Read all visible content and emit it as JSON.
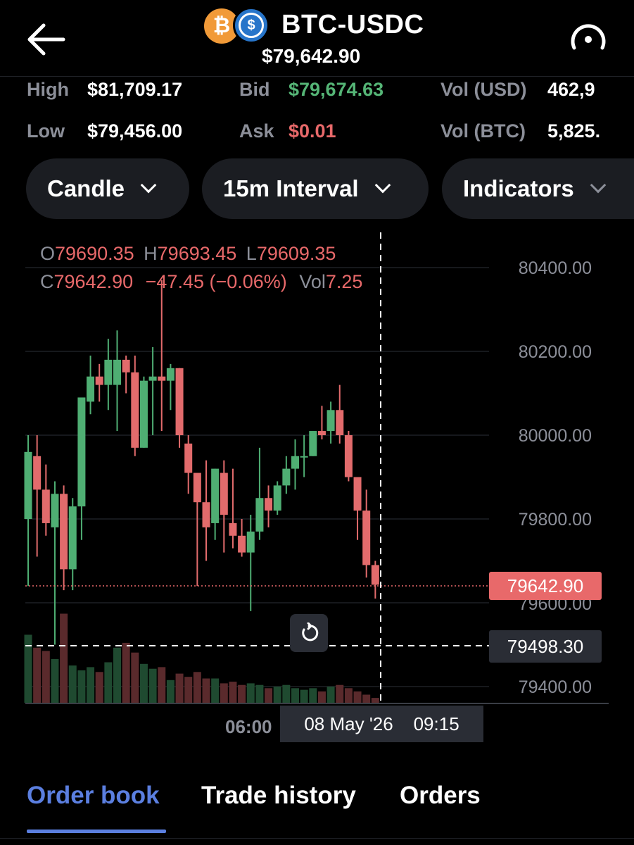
{
  "header": {
    "pair": "BTC-USDC",
    "price": "$79,642.90",
    "coin1_symbol": "₿",
    "coin2_symbol": "$"
  },
  "stats": {
    "high_label": "High",
    "high_value": "$81,709.17",
    "low_label": "Low",
    "low_value": "$79,456.00",
    "bid_label": "Bid",
    "bid_value": "$79,674.63",
    "ask_label": "Ask",
    "ask_value": "$0.01",
    "volusd_label": "Vol (USD)",
    "volusd_value": "462,9",
    "volbtc_label": "Vol (BTC)",
    "volbtc_value": "5,825."
  },
  "controls": {
    "chart_type": "Candle",
    "interval": "15m Interval",
    "indicators": "Indicators"
  },
  "ohlc": {
    "o_label": "O",
    "o_value": "79690.35",
    "h_label": "H",
    "h_value": "79693.45",
    "l_label": "L",
    "l_value": "79609.35",
    "c_label": "C",
    "c_value": "79642.90",
    "change": "−47.45 (−0.06%)",
    "vol_label": "Vol",
    "vol_value": "7.25"
  },
  "chart_data": {
    "type": "candlestick",
    "y_ticks": [
      "80400.00",
      "80200.00",
      "80000.00",
      "79800.00",
      "79600.00",
      "79400.00"
    ],
    "ylim": [
      79350,
      80500
    ],
    "x_tick": "06:00",
    "last_price_tag": "79642.90",
    "crosshair_price_tag": "79498.30",
    "crosshair_time": "08 May '26    09:15",
    "grid": true,
    "candles": [
      {
        "o": 79800,
        "h": 80000,
        "l": 79640,
        "c": 79960
      },
      {
        "o": 79950,
        "h": 80000,
        "l": 79710,
        "c": 79870
      },
      {
        "o": 79870,
        "h": 79930,
        "l": 79760,
        "c": 79790
      },
      {
        "o": 79780,
        "h": 79890,
        "l": 79500,
        "c": 79860
      },
      {
        "o": 79860,
        "h": 79880,
        "l": 79630,
        "c": 79680
      },
      {
        "o": 79680,
        "h": 79850,
        "l": 79630,
        "c": 79830
      },
      {
        "o": 79830,
        "h": 80060,
        "l": 79750,
        "c": 80090
      },
      {
        "o": 80080,
        "h": 80190,
        "l": 80050,
        "c": 80140
      },
      {
        "o": 80140,
        "h": 80170,
        "l": 80080,
        "c": 80120
      },
      {
        "o": 80120,
        "h": 80230,
        "l": 80060,
        "c": 80180
      },
      {
        "o": 80120,
        "h": 80250,
        "l": 80010,
        "c": 80180
      },
      {
        "o": 80180,
        "h": 80190,
        "l": 80100,
        "c": 80150
      },
      {
        "o": 80150,
        "h": 80190,
        "l": 79950,
        "c": 79970
      },
      {
        "o": 79970,
        "h": 80140,
        "l": 79970,
        "c": 80130
      },
      {
        "o": 80130,
        "h": 80210,
        "l": 80000,
        "c": 80140
      },
      {
        "o": 80140,
        "h": 80370,
        "l": 80010,
        "c": 80130
      },
      {
        "o": 80130,
        "h": 80170,
        "l": 80060,
        "c": 80160
      },
      {
        "o": 80160,
        "h": 80160,
        "l": 79970,
        "c": 80000
      },
      {
        "o": 79980,
        "h": 80000,
        "l": 79860,
        "c": 79910
      },
      {
        "o": 79910,
        "h": 79890,
        "l": 79640,
        "c": 79840
      },
      {
        "o": 79840,
        "h": 79940,
        "l": 79700,
        "c": 79780
      },
      {
        "o": 79790,
        "h": 79920,
        "l": 79750,
        "c": 79920
      },
      {
        "o": 79910,
        "h": 79940,
        "l": 79720,
        "c": 79810
      },
      {
        "o": 79790,
        "h": 79920,
        "l": 79730,
        "c": 79760
      },
      {
        "o": 79760,
        "h": 79800,
        "l": 79710,
        "c": 79720
      },
      {
        "o": 79720,
        "h": 79810,
        "l": 79580,
        "c": 79770
      },
      {
        "o": 79770,
        "h": 79970,
        "l": 79750,
        "c": 79850
      },
      {
        "o": 79850,
        "h": 79880,
        "l": 79780,
        "c": 79820
      },
      {
        "o": 79820,
        "h": 79890,
        "l": 79810,
        "c": 79880
      },
      {
        "o": 79880,
        "h": 79950,
        "l": 79860,
        "c": 79920
      },
      {
        "o": 79920,
        "h": 79990,
        "l": 79870,
        "c": 79950
      },
      {
        "o": 79950,
        "h": 80000,
        "l": 79900,
        "c": 79950
      },
      {
        "o": 79950,
        "h": 80000,
        "l": 79950,
        "c": 80010
      },
      {
        "o": 80010,
        "h": 80070,
        "l": 79990,
        "c": 80000
      },
      {
        "o": 80010,
        "h": 80080,
        "l": 79980,
        "c": 80060
      },
      {
        "o": 80060,
        "h": 80120,
        "l": 79980,
        "c": 80000
      },
      {
        "o": 80000,
        "h": 80010,
        "l": 79890,
        "c": 79900
      },
      {
        "o": 79900,
        "h": 79900,
        "l": 79750,
        "c": 79820
      },
      {
        "o": 79820,
        "h": 79870,
        "l": 79660,
        "c": 79690
      },
      {
        "o": 79690,
        "h": 79700,
        "l": 79610,
        "c": 79643
      }
    ],
    "volumes": [
      0.42,
      0.34,
      0.32,
      0.27,
      0.55,
      0.23,
      0.2,
      0.22,
      0.19,
      0.25,
      0.34,
      0.37,
      0.31,
      0.24,
      0.21,
      0.22,
      0.14,
      0.18,
      0.16,
      0.19,
      0.15,
      0.15,
      0.12,
      0.13,
      0.11,
      0.12,
      0.11,
      0.09,
      0.1,
      0.11,
      0.09,
      0.08,
      0.09,
      0.07,
      0.1,
      0.11,
      0.09,
      0.07,
      0.05,
      0.03
    ],
    "colors": {
      "up": "#4fae73",
      "down": "#e26b6c",
      "grid": "#1e2026",
      "volume_up": "#1f4a30",
      "volume_down": "#5a2a2c"
    }
  },
  "tabs": [
    "Order book",
    "Trade history",
    "Orders"
  ]
}
